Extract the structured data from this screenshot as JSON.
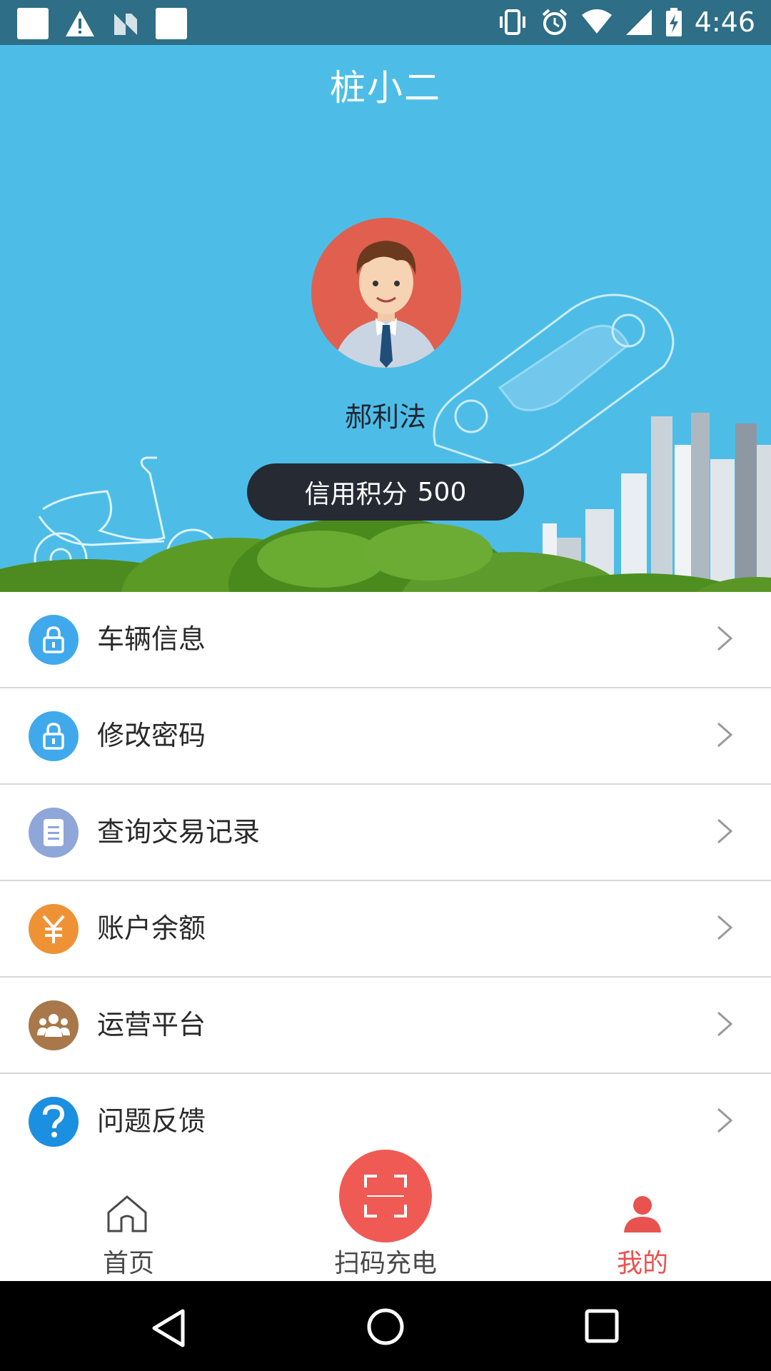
{
  "status_bar": {
    "time": "4:46",
    "icons": [
      "notification-square-icon",
      "warning-icon",
      "n-icon",
      "notification-square-icon",
      "vibrate-icon",
      "alarm-icon",
      "wifi-icon",
      "signal-icon",
      "battery-charging-icon"
    ]
  },
  "app": {
    "title": "桩小二"
  },
  "profile": {
    "name": "郝利法",
    "credit_label": "信用积分",
    "credit_value": "500"
  },
  "menu": {
    "items": [
      {
        "label": "车辆信息",
        "icon": "lock-icon",
        "color": "#3fa9ec"
      },
      {
        "label": "修改密码",
        "icon": "lock-icon",
        "color": "#3fa9ec"
      },
      {
        "label": "查询交易记录",
        "icon": "document-icon",
        "color": "#8fa6d9"
      },
      {
        "label": "账户余额",
        "icon": "yen-icon",
        "color": "#ef9236"
      },
      {
        "label": "运营平台",
        "icon": "group-icon",
        "color": "#a8784a"
      },
      {
        "label": "问题反馈",
        "icon": "question-icon",
        "color": "#1b8fe0"
      }
    ]
  },
  "tabbar": {
    "home_label": "首页",
    "scan_label": "扫码充电",
    "me_label": "我的",
    "active_color": "#e8524f"
  },
  "colors": {
    "header_bg": "#4dbde8",
    "status_bar": "#2e6e86",
    "scan_button": "#f05a55"
  }
}
